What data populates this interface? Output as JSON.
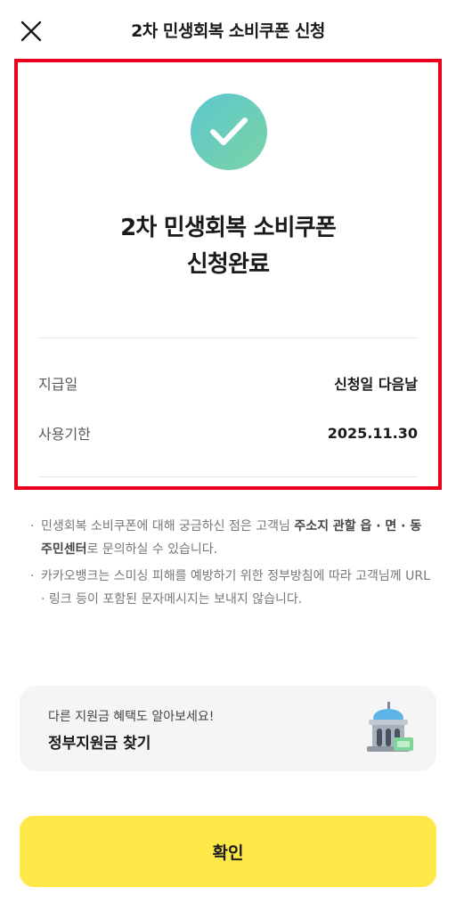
{
  "header": {
    "title": "2차 민생회복 소비쿠폰 신청"
  },
  "result": {
    "title_line1": "2차 민생회복 소비쿠폰",
    "title_line2": "신청완료",
    "rows": [
      {
        "label": "지급일",
        "value": "신청일 다음날"
      },
      {
        "label": "사용기한",
        "value": "2025.11.30"
      }
    ]
  },
  "notices": [
    {
      "bullet": "·",
      "pre": "민생회복 소비쿠폰에 대해 궁금하신 점은 고객님 ",
      "bold": "주소지 관할 읍 · 면 · 동 주민센터",
      "post": "로 문의하실 수 있습니다."
    },
    {
      "bullet": "·",
      "text": "카카오뱅크는 스미싱 피해를 예방하기 위한 정부방침에 따라 고객님께 URL · 링크 등이 포함된 문자메시지는 보내지 않습니다."
    }
  ],
  "promo": {
    "subtitle": "다른 지원금 혜택도 알아보세요!",
    "title": "정부지원금 찾기"
  },
  "confirm_label": "확인",
  "colors": {
    "highlight": "#e8001c",
    "confirm_bg": "#fde848",
    "check_start": "#5cc8cf",
    "check_end": "#7bd2a4"
  },
  "icons": {
    "close": "close-icon",
    "check": "check-icon",
    "promo": "government-building-icon"
  }
}
